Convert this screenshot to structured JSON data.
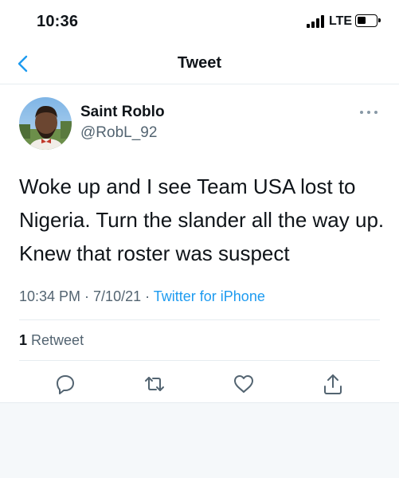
{
  "status_bar": {
    "time": "10:36",
    "network": "LTE"
  },
  "nav": {
    "back_icon": "chevron-left-icon",
    "title": "Tweet"
  },
  "tweet": {
    "author": {
      "display_name": "Saint Roblo",
      "handle": "@RobL_92"
    },
    "text": "Woke up and I see Team USA lost to Nigeria. Turn the slander all the way up. Knew that roster was suspect",
    "time": "10:34 PM",
    "separator": " · ",
    "date": "7/10/21",
    "source": "Twitter for iPhone",
    "retweet_count": "1",
    "retweet_label": "Retweet"
  },
  "actions": [
    "reply-icon",
    "retweet-icon",
    "like-icon",
    "share-icon"
  ],
  "colors": {
    "accent": "#1d9bf0",
    "secondary_text": "#536471",
    "divider": "#e6ecf0"
  }
}
